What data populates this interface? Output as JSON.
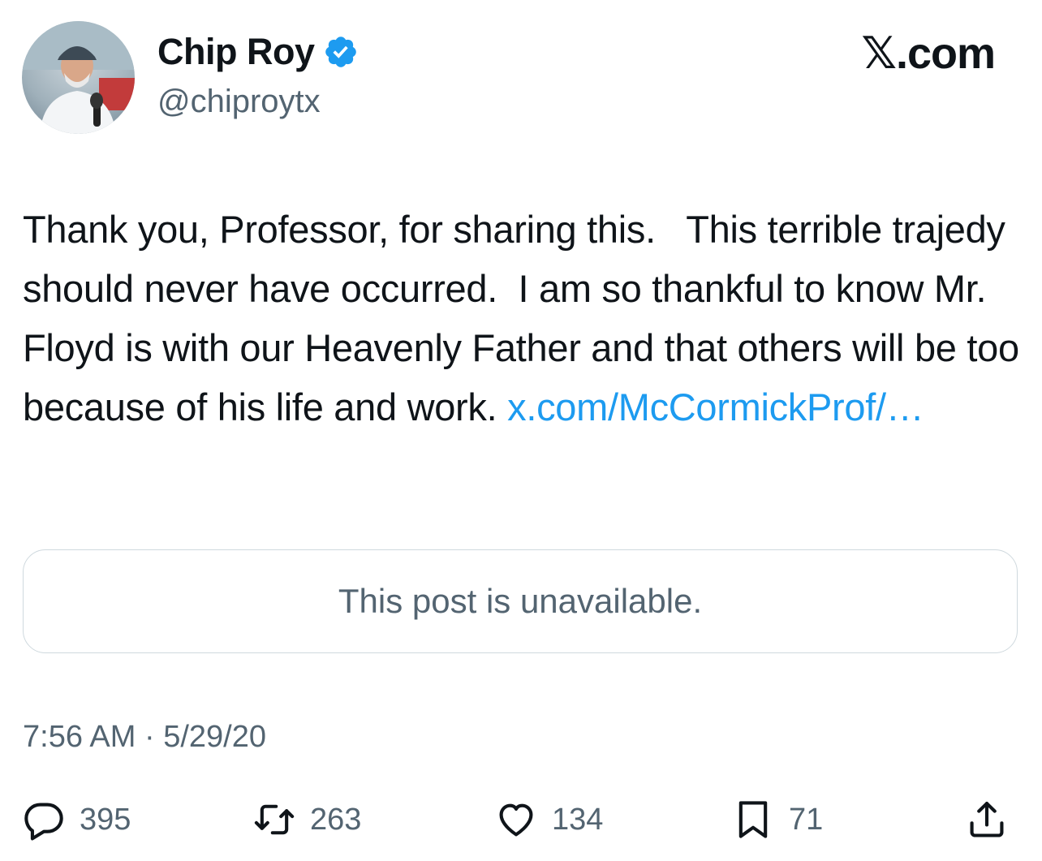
{
  "site_label": "𝕏.com",
  "author": {
    "display_name": "Chip Roy",
    "handle": "@chiproytx",
    "verified": true,
    "avatar_icon": "profile-photo"
  },
  "post": {
    "text": "Thank you, Professor, for sharing this.   This terrible trajedy should never have occurred.  I am so thankful to know Mr. Floyd is with our Heavenly Father and that others will be too because of his life and work. ",
    "link": "x.com/McCormickProf/…",
    "quoted_post_notice": "This post is unavailable.",
    "timestamp": "7:56 AM · 5/29/20"
  },
  "actions": {
    "replies": {
      "icon": "reply-icon",
      "count": "395"
    },
    "reposts": {
      "icon": "repost-icon",
      "count": "263"
    },
    "likes": {
      "icon": "heart-icon",
      "count": "134"
    },
    "bookmarks": {
      "icon": "bookmark-icon",
      "count": "71"
    },
    "share": {
      "icon": "share-icon"
    }
  },
  "colors": {
    "text": "#0f1419",
    "secondary": "#536471",
    "link": "#1d9bf0",
    "border": "#cfd9de",
    "verified": "#1d9bf0"
  }
}
